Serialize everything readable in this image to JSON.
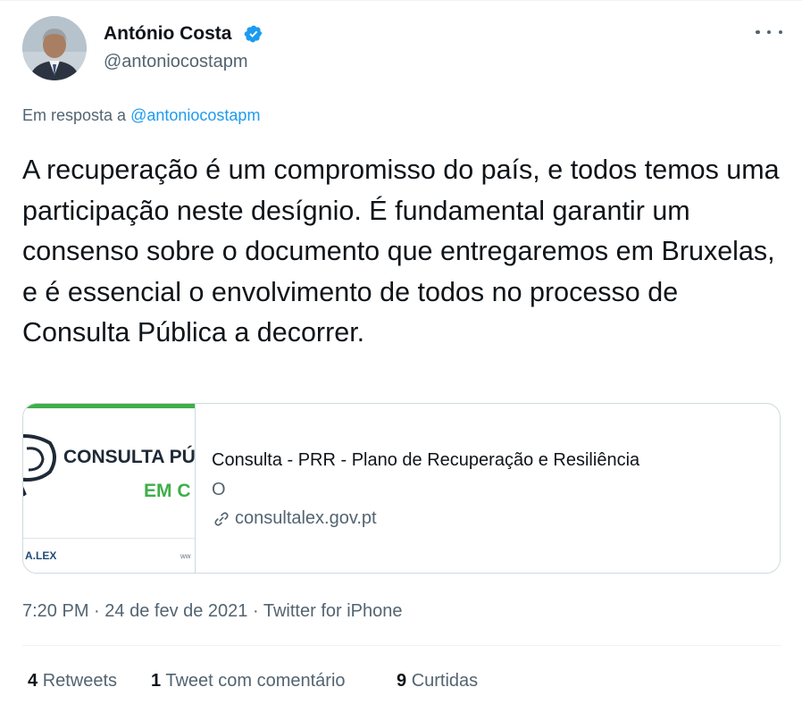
{
  "author": {
    "name": "António Costa",
    "handle": "@antoniocostapm",
    "verified": true
  },
  "reply": {
    "prefix": "Em resposta a",
    "to": "@antoniocostapm"
  },
  "tweet": {
    "text": "A recuperação é um compromisso do país, e todos temos uma participação neste desígnio. É fundamental garantir um consenso sobre o documento que entregaremos em Bruxelas, e é essencial o envolvimento de todos no processo de Consulta Pública a decorrer."
  },
  "card": {
    "thumbnail": {
      "title": "CONSULTA PÚ",
      "subtitle": "EM C",
      "brand": "A.LEX",
      "www": "ww"
    },
    "title": "Consulta - PRR - Plano de Recuperação e Resiliência",
    "description": "O",
    "domain": "consultalex.gov.pt"
  },
  "meta": {
    "time": "7:20 PM",
    "date": "24 de fev de 2021",
    "source": "Twitter for iPhone",
    "separator": "·"
  },
  "stats": {
    "retweets_count": "4",
    "retweets_label": "Retweets",
    "quotes_count": "1",
    "quotes_label": "Tweet com comentário",
    "likes_count": "9",
    "likes_label": "Curtidas"
  },
  "colors": {
    "accent": "#1d9bf0",
    "secondary_text": "#536471",
    "primary_text": "#0f1419",
    "thumbnail_green": "#3fae49"
  },
  "icons": {
    "verified": "verified-badge-icon",
    "more": "more-horizontal-icon",
    "link": "link-icon"
  }
}
